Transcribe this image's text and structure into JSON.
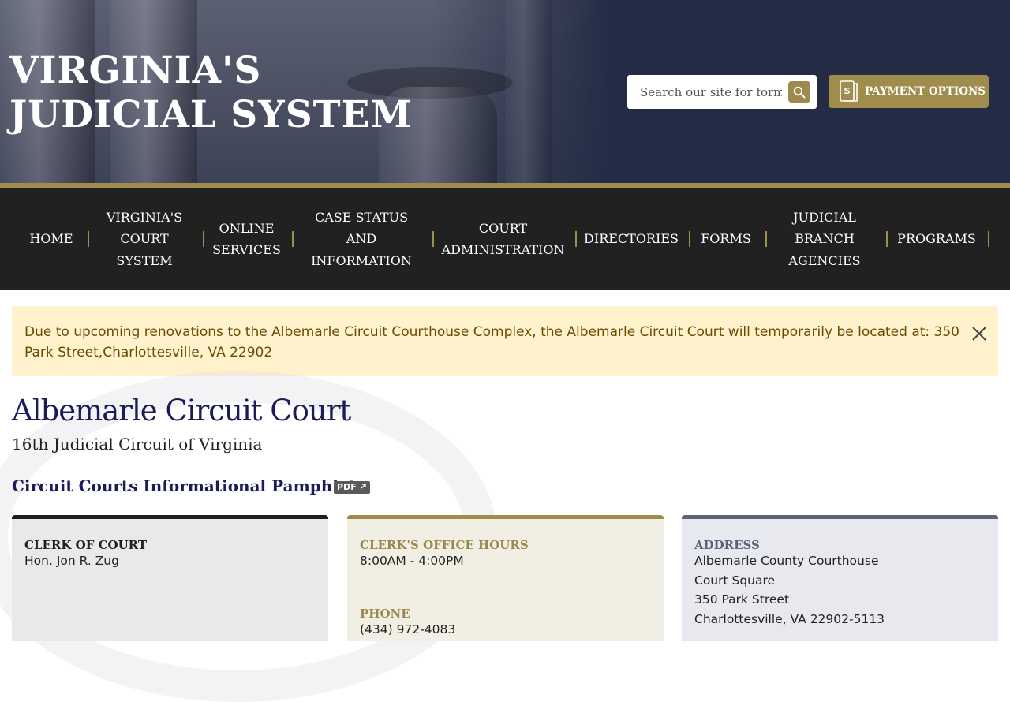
{
  "header": {
    "site_title": "VIRGINIA'S JUDICIAL SYSTEM",
    "search_placeholder": "Search our site for forms, ...",
    "payment_label": "PAYMENT OPTIONS"
  },
  "nav": {
    "items": [
      {
        "label": "HOME"
      },
      {
        "label": "VIRGINIA'S COURT SYSTEM"
      },
      {
        "label": "ONLINE SERVICES"
      },
      {
        "label": "CASE STATUS AND INFORMATION"
      },
      {
        "label": "COURT ADMINISTRATION"
      },
      {
        "label": "DIRECTORIES"
      },
      {
        "label": "FORMS"
      },
      {
        "label": "JUDICIAL BRANCH AGENCIES"
      },
      {
        "label": "PROGRAMS"
      }
    ]
  },
  "alert": {
    "text": "Due to upcoming renovations to the Albemarle Circuit Courthouse Complex, the Albemarle Circuit Court will temporarily be located at: 350 Park Street,Charlottesville, VA 22902"
  },
  "main": {
    "title": "Albemarle Circuit Court",
    "subtitle": "16th Judicial Circuit of Virginia",
    "pamphlet_link": "Circuit Courts Informational Pamphlet",
    "pdf_badge": "PDF"
  },
  "cards": {
    "clerk": {
      "label": "CLERK OF COURT",
      "value": "Hon. Jon R. Zug"
    },
    "hours": {
      "label": "CLERK'S OFFICE HOURS",
      "value": "8:00AM - 4:00PM",
      "phone_label": "PHONE",
      "phone_value": "(434) 972-4083"
    },
    "address": {
      "label": "ADDRESS",
      "lines": [
        "Albemarle County Courthouse",
        "Court Square",
        "350 Park Street",
        "Charlottesville, VA 22902-5113"
      ]
    }
  },
  "colors": {
    "navy": "#232b45",
    "gold": "#a08c4c",
    "nav_bg": "#212121",
    "alert_bg": "#fff2cc",
    "alert_text": "#6a4c00",
    "title_blue": "#1b1b5a"
  },
  "icons": {
    "search": "search-icon",
    "payment": "receipt-dollar-icon",
    "close": "close-icon",
    "external": "external-link-icon"
  }
}
